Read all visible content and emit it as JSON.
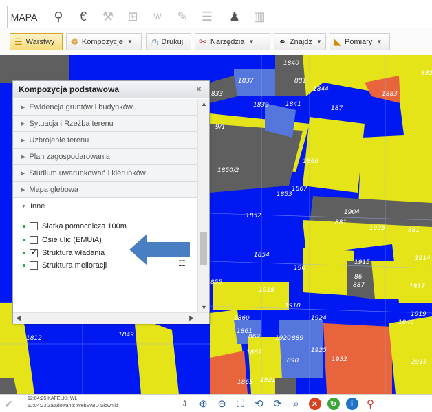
{
  "tabs": {
    "mapa": "MAPA",
    "icons": [
      {
        "name": "surveyor-icon",
        "glyph": "⚲",
        "dim": false
      },
      {
        "name": "euro-icon",
        "glyph": "€",
        "dim": false
      },
      {
        "name": "gavel-icon",
        "glyph": "⚒",
        "dim": true
      },
      {
        "name": "cart-icon",
        "glyph": "⊞",
        "dim": true
      },
      {
        "name": "compass-w-icon",
        "glyph": "W",
        "dim": true
      },
      {
        "name": "form-edit-icon",
        "glyph": "✎",
        "dim": true
      },
      {
        "name": "document-list-icon",
        "glyph": "☰",
        "dim": true
      },
      {
        "name": "user-icon",
        "glyph": "♟",
        "dim": false
      },
      {
        "name": "buildings-icon",
        "glyph": "▥",
        "dim": true
      }
    ]
  },
  "toolbar": {
    "warstwy": "Warstwy",
    "kompozycje": "Kompozycje",
    "drukuj": "Drukuj",
    "narzedzia": "Narzędzia",
    "znajdz": "Znajdź",
    "pomiary": "Pomiary"
  },
  "panel": {
    "title": "Kompozycja podstawowa",
    "close": "×",
    "groups": [
      "Ewidencja gruntów i budynków",
      "Sytuacja i Rzeźba terenu",
      "Uzbrojenie terenu",
      "Plan zagospodarowania",
      "Studium uwarunkowań i kierunków",
      "Mapa glebowa"
    ],
    "open_group": "Inne",
    "layers": [
      {
        "label": "Siatka pomocnicza 100m",
        "checked": false
      },
      {
        "label": "Osie ulic (EMUiA)",
        "checked": false
      },
      {
        "label": "Struktura władania",
        "checked": true
      },
      {
        "label": "Struktura melioracji",
        "checked": false
      }
    ]
  },
  "map_labels": [
    "1840",
    "882",
    "1837",
    "881",
    "1844",
    "1883",
    "833",
    "1839",
    "1841",
    "187",
    "9/1",
    "1850/2",
    "1853",
    "1867",
    "1866",
    "1904",
    "1852",
    "881",
    "1905",
    "881",
    "1854",
    "190",
    "1915",
    "1914",
    "855",
    "1918",
    "86",
    "887",
    "1917",
    "1910",
    "1924",
    "1919",
    "1940",
    "1860",
    "1861",
    "862",
    "1920",
    "889",
    "1812",
    "1849",
    "1862",
    "1925",
    "890",
    "1932",
    "2918",
    "1863",
    "1921"
  ],
  "status": {
    "log1": "12:04:25 KAFELKI: WŁ",
    "log2": "12:04:23 Załadowano: WebEWID Słowniki"
  },
  "colors": {
    "map_blue": "#0018f2",
    "parcel_yellow": "#e4e419",
    "building_gray": "#5f5f5f",
    "light_blue": "#5577dd",
    "orange": "#e7643d",
    "arrow": "#4a7ec2"
  }
}
